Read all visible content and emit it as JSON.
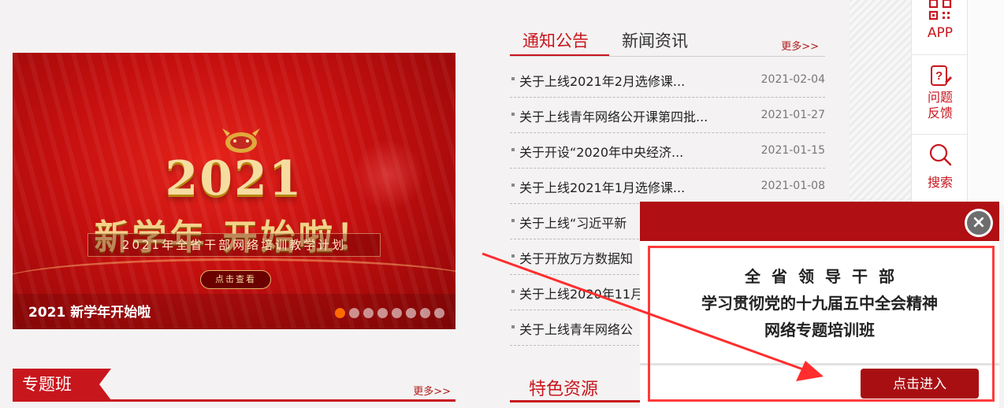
{
  "banner": {
    "year": "2021",
    "slogan": "新学年 开始啦！",
    "plan": "2021年全省干部网络培训教学计划",
    "cta": "点击查看",
    "caption": "2021 新学年开始啦",
    "slide_count": 8,
    "active_slide": 1
  },
  "special_classes": {
    "title": "专题班",
    "more": "更多>>"
  },
  "news": {
    "tabs": [
      "通知公告",
      "新闻资讯"
    ],
    "active_tab": 0,
    "more": "更多>>",
    "items": [
      {
        "title": "关于上线2021年2月选修课...",
        "date": "2021-02-04"
      },
      {
        "title": "关于上线青年网络公开课第四批...",
        "date": "2021-01-27"
      },
      {
        "title": "关于开设“2020年中央经济...",
        "date": "2021-01-15"
      },
      {
        "title": "关于上线2021年1月选修课...",
        "date": "2021-01-08"
      },
      {
        "title": "关于上线“习近平新",
        "date": ""
      },
      {
        "title": "关于开放万方数据知",
        "date": ""
      },
      {
        "title": "关于上线2020年11月",
        "date": ""
      },
      {
        "title": "关于上线青年网络公",
        "date": ""
      }
    ]
  },
  "featured": {
    "title": "特色资源"
  },
  "sidebar": {
    "items": [
      {
        "label": "APP",
        "icon": "qr-code-icon"
      },
      {
        "label_line1": "问题",
        "label_line2": "反馈",
        "icon": "feedback-icon"
      },
      {
        "label": "搜索",
        "icon": "search-icon"
      }
    ]
  },
  "popup": {
    "line1": "全省领导干部",
    "line2": "学习贯彻党的十九届五中全会精神",
    "line3": "网络专题培训班",
    "enter_label": "点击进入",
    "close_label": "×",
    "accent": "#b00f13"
  }
}
